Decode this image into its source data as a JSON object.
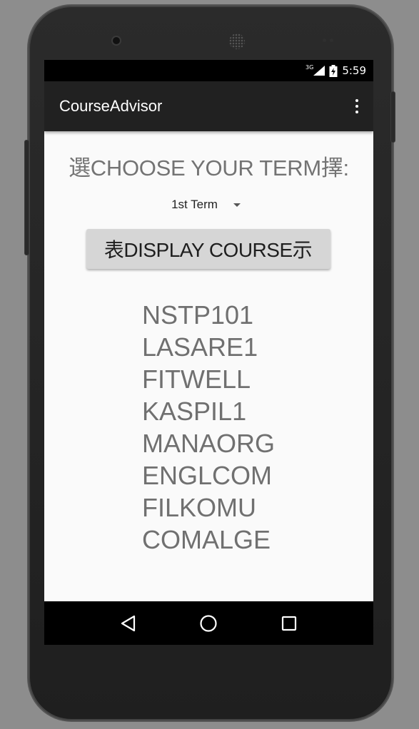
{
  "status_bar": {
    "network_label": "3G",
    "time": "5:59"
  },
  "app_bar": {
    "title": "CourseAdvisor",
    "overflow_icon": "more-vert-icon"
  },
  "main": {
    "prompt": "選CHOOSE YOUR TERM擇:",
    "term_spinner": {
      "selected": "1st Term"
    },
    "display_button_label": "表DISPLAY COURSE示",
    "courses": [
      "NSTP101",
      "LASARE1",
      "FITWELL",
      "KASPIL1",
      "MANAORG",
      "ENGLCOM",
      "FILKOMU",
      "COMALGE"
    ]
  },
  "nav_bar": {
    "back_icon": "back-triangle-icon",
    "home_icon": "home-circle-icon",
    "recents_icon": "recents-square-icon"
  }
}
